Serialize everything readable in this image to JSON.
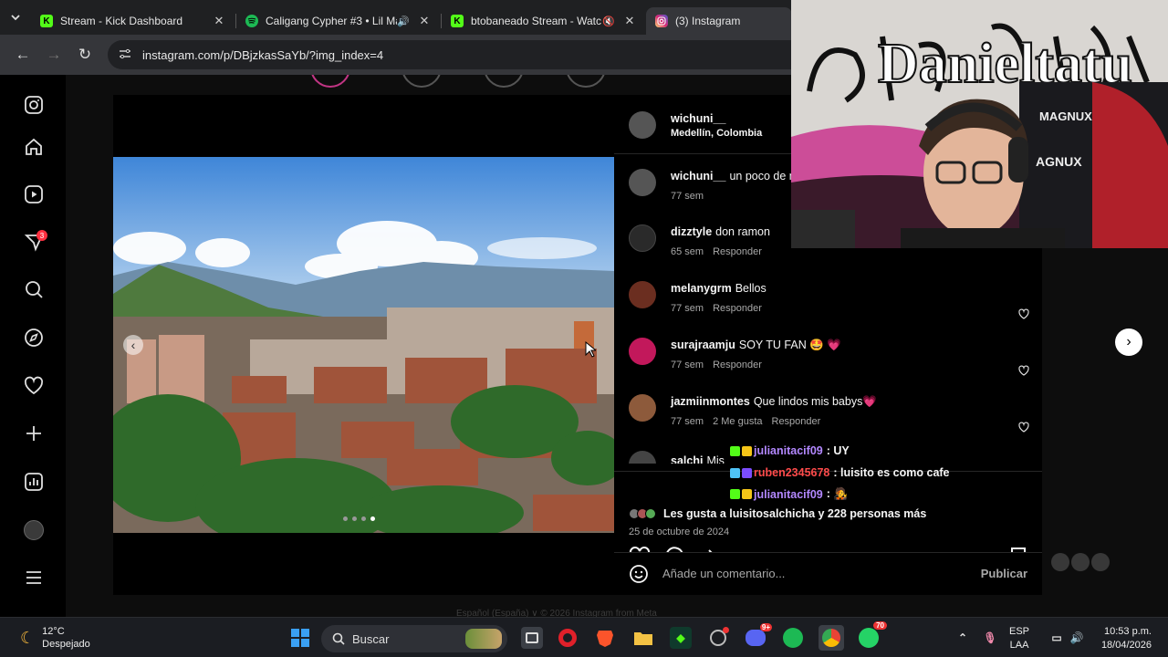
{
  "tabs": [
    {
      "title": "Stream - Kick Dashboard",
      "icon": "kick-icon",
      "active": false
    },
    {
      "title": "Caligang Cypher #3 • Lil Ma",
      "icon": "spotify-icon",
      "active": false
    },
    {
      "title": "btobaneado Stream - Watc",
      "icon": "kick-icon",
      "active": false
    },
    {
      "title": "(3) Instagram",
      "icon": "instagram-icon",
      "active": true
    }
  ],
  "toolbar": {
    "url": "instagram.com/p/DBjzkasSaYb/?img_index=4"
  },
  "sidebar": {
    "notification_count": "3"
  },
  "post": {
    "author": "wichuni__",
    "location": "Medellín, Colombia",
    "caption_user": "wichuni__",
    "caption_text": "un poco de m",
    "caption_time": "77 sem",
    "comments": [
      {
        "user": "dizztyle",
        "text": "don ramon",
        "time": "65 sem",
        "likes": "",
        "reply": "Responder",
        "color": "#2a2a2a"
      },
      {
        "user": "melanygrm",
        "text": "Bellos",
        "time": "77 sem",
        "likes": "",
        "reply": "Responder",
        "color": "#6b2e20"
      },
      {
        "user": "surajraamju",
        "text": "SOY TU FAN 🤩 💗",
        "time": "77 sem",
        "likes": "",
        "reply": "Responder",
        "color": "#c2185b"
      },
      {
        "user": "jazmiinmontes",
        "text": "Que lindos mis babys💗",
        "time": "77 sem",
        "likes": "2 Me gusta",
        "reply": "Responder",
        "color": "#8d5a3b"
      }
    ],
    "partial_comment": {
      "user": "salchi",
      "text": "Mis"
    },
    "likes_text": "Les gusta a luisitosalchicha y 228 personas más",
    "date": "25 de octubre de 2024",
    "add_comment_placeholder": "Añade un comentario...",
    "publish_label": "Publicar"
  },
  "chat_overlay": [
    {
      "user": "julianitacif09",
      "msg": ": UY",
      "color": "#b388ff"
    },
    {
      "user": "ruben2345678",
      "msg": ": luisito es como cafe",
      "color": "#ff4b4b"
    },
    {
      "user": "julianitacif09",
      "msg": ": 🧑‍🎤",
      "color": "#b388ff"
    }
  ],
  "footer": "Español (España) ∨  © 2026 Instagram from Meta",
  "webcam": {
    "graffiti_text": "Danieltatu",
    "chair_text": "MAGNUX",
    "chair_text2": "AGNUX"
  },
  "taskbar": {
    "weather_temp": "12°C",
    "weather_desc": "Despejado",
    "search_label": "Buscar",
    "language": "ESP",
    "language2": "LAA",
    "time": "10:53 p.m.",
    "date": "18/04/2026",
    "discord_badge": "9+",
    "whatsapp_badge": "70"
  }
}
